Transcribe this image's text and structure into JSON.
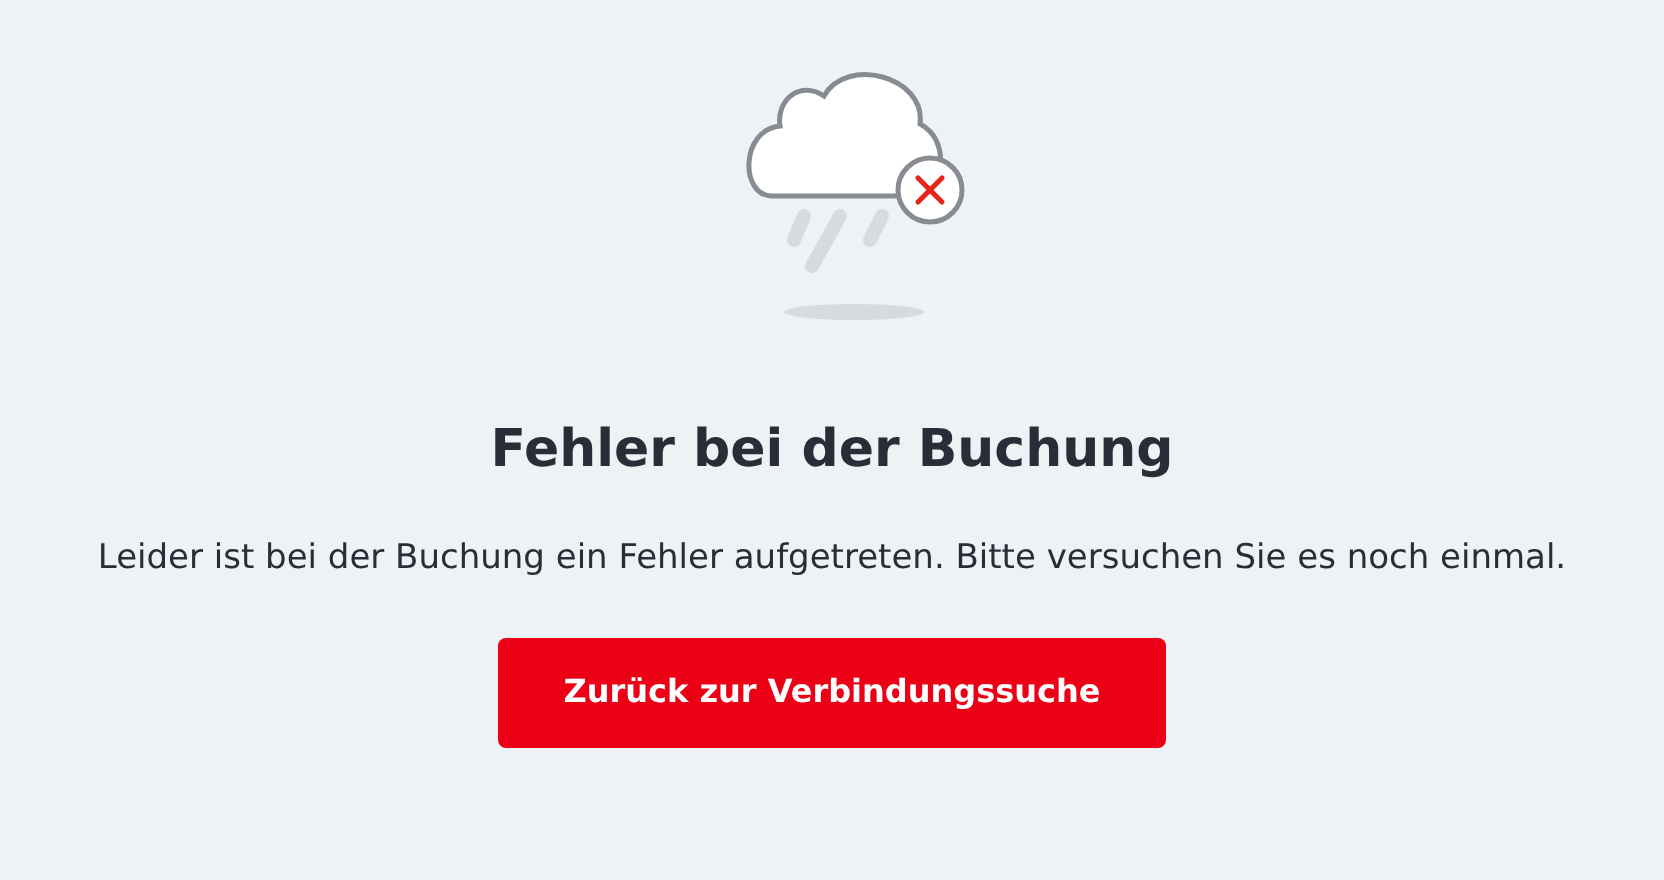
{
  "title": "Fehler bei der Buchung",
  "message": "Leider ist bei der Buchung ein Fehler aufgetreten. Bitte versuchen Sie es noch einmal.",
  "button": "Zurück zur Verbindungssuche"
}
